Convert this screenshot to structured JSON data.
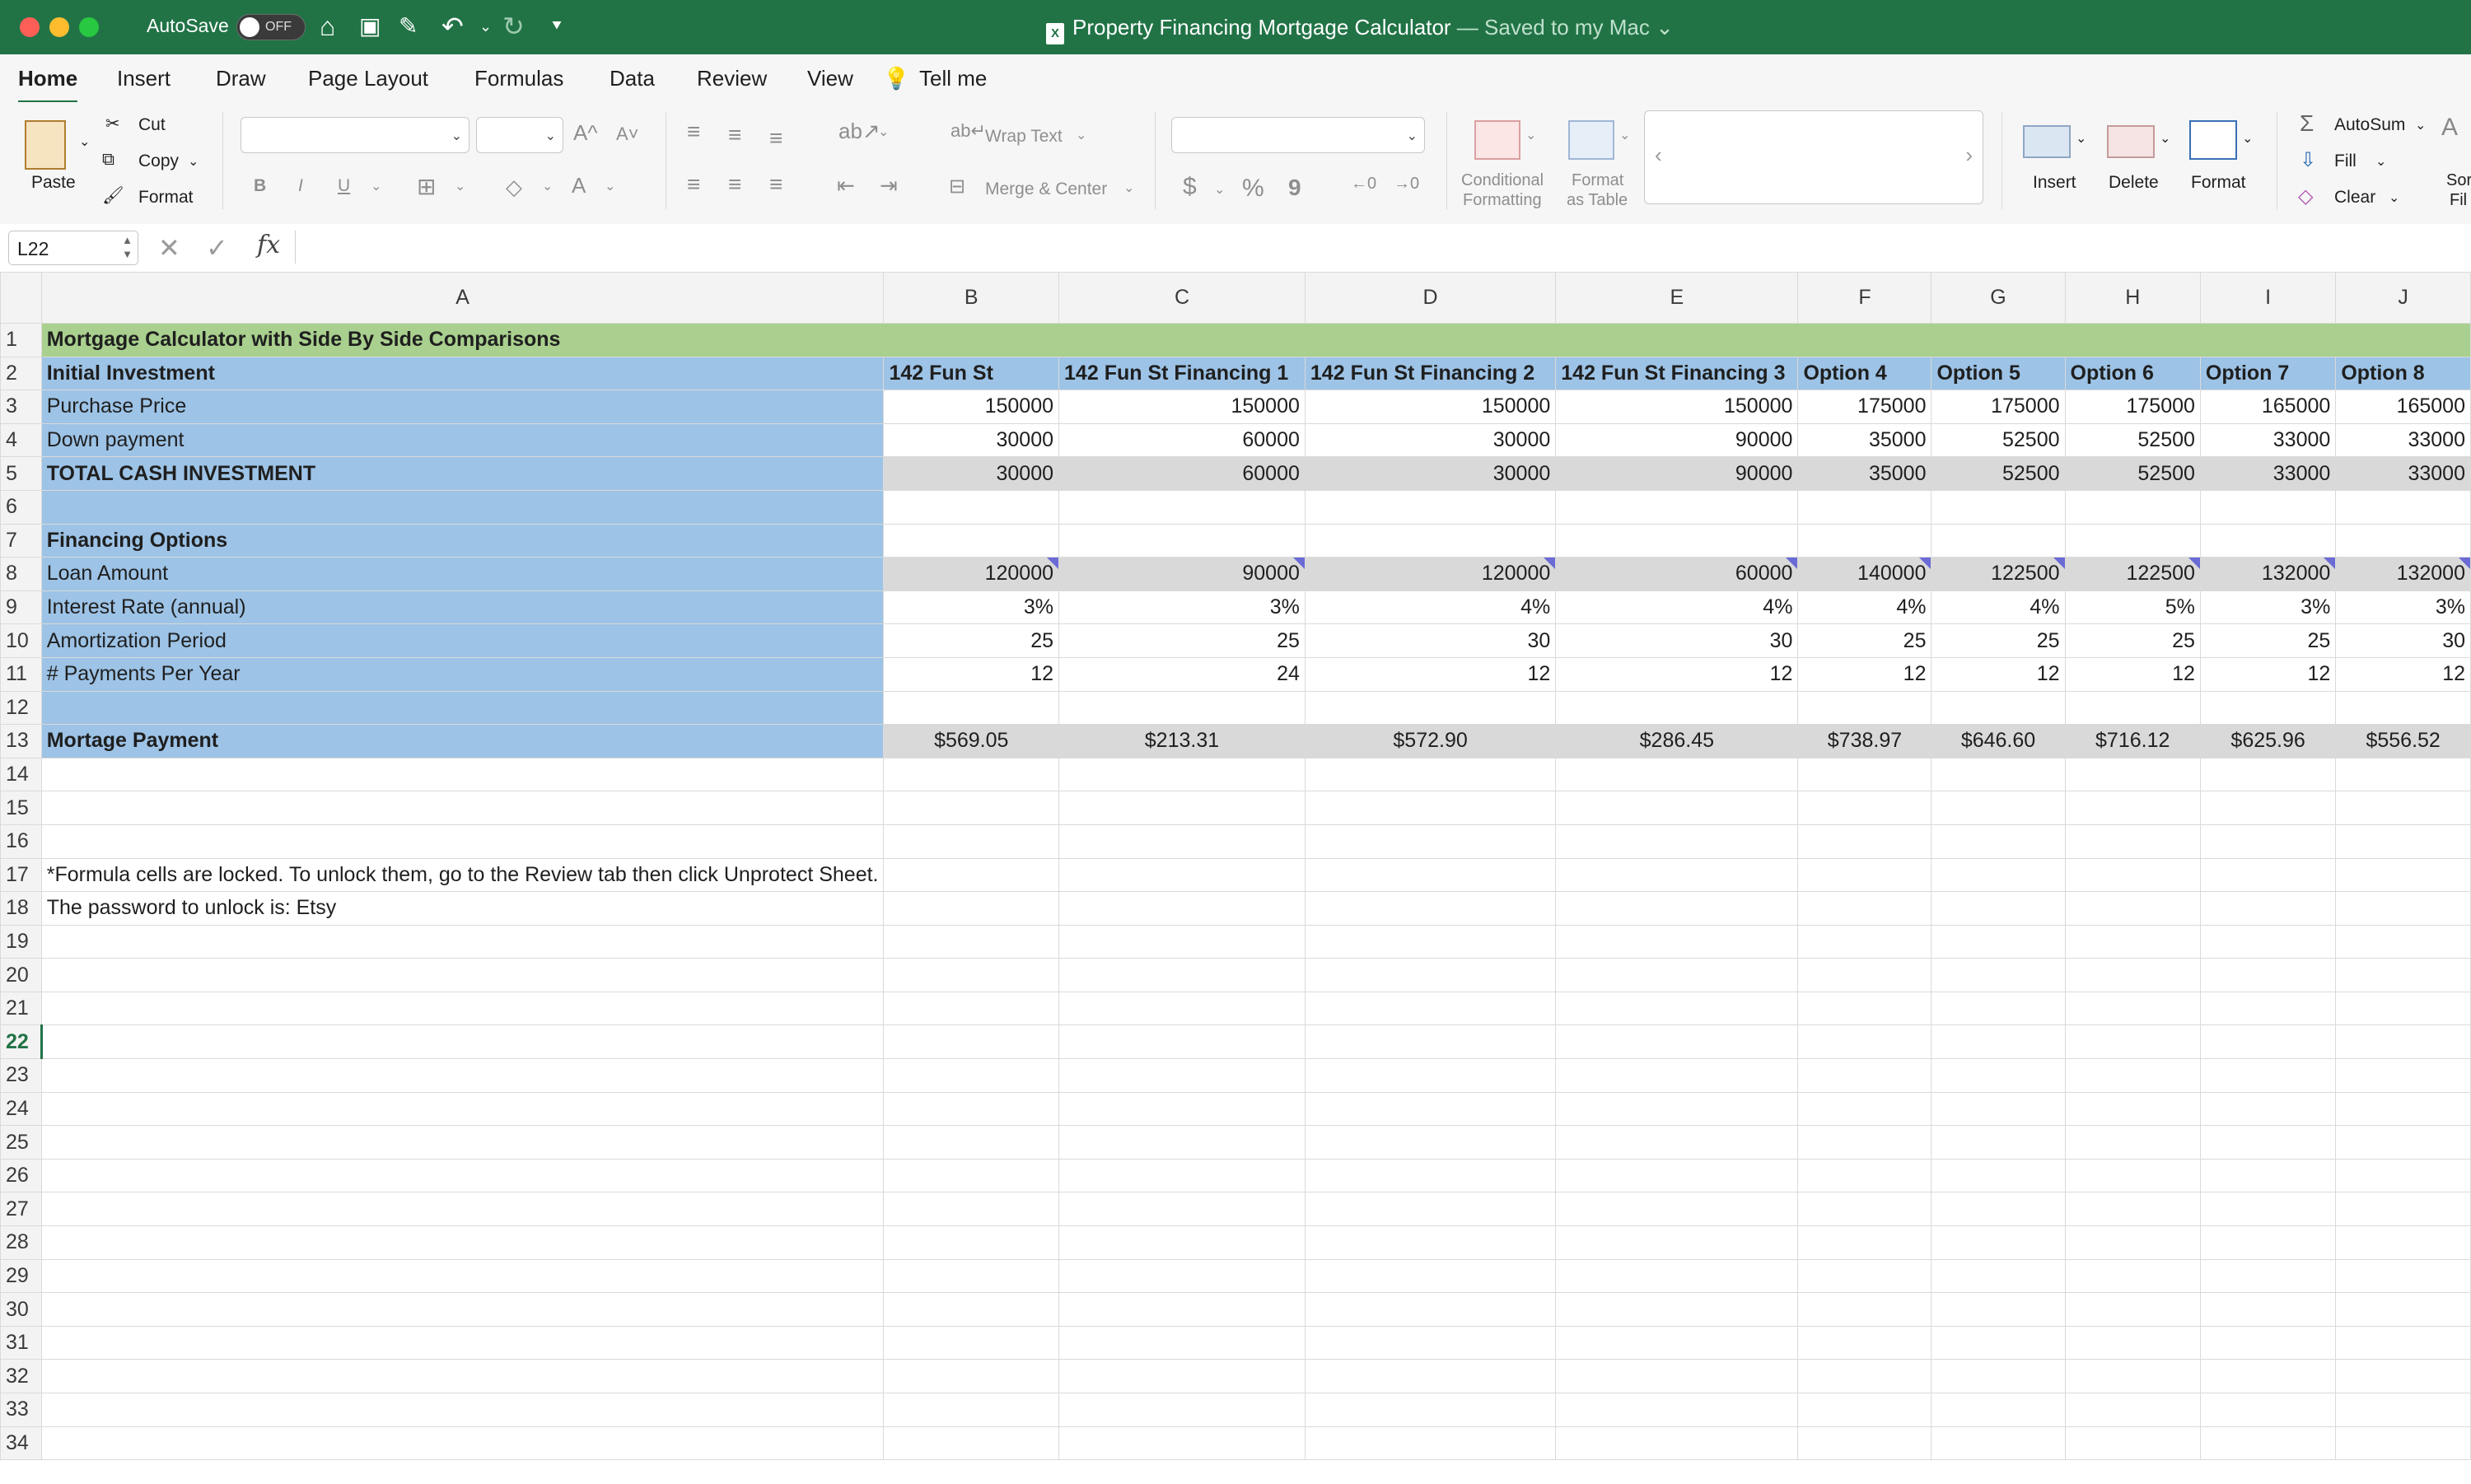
{
  "titlebar": {
    "autosave_label": "AutoSave",
    "autosave_state": "OFF",
    "doc_title": "Property Financing Mortgage Calculator",
    "saved_status": "— Saved to my Mac",
    "icons": [
      "home-icon",
      "save-icon",
      "save-as-icon",
      "undo-icon",
      "redo-icon",
      "customize-icon"
    ]
  },
  "menu": {
    "tabs": [
      "Home",
      "Insert",
      "Draw",
      "Page Layout",
      "Formulas",
      "Data",
      "Review",
      "View",
      "Tell me"
    ]
  },
  "ribbon": {
    "paste": "Paste",
    "cut": "Cut",
    "copy": "Copy",
    "format_painter": "Format",
    "bold": "B",
    "italic": "I",
    "underline": "U",
    "wrap_text": "Wrap Text",
    "merge_center": "Merge & Center",
    "currency": "$",
    "percent": "%",
    "comma": "9",
    "conditional_formatting": [
      "Conditional",
      "Formatting"
    ],
    "format_as_table": [
      "Format",
      "as Table"
    ],
    "insert": "Insert",
    "delete": "Delete",
    "format": "Format",
    "autosum": "AutoSum",
    "fill": "Fill",
    "clear": "Clear",
    "sort_filter": [
      "Sor",
      "Fil"
    ]
  },
  "formula_bar": {
    "name_box": "L22",
    "fx": "fx",
    "value": ""
  },
  "sheet": {
    "columns": [
      "A",
      "B",
      "C",
      "D",
      "E",
      "F",
      "G",
      "H",
      "I",
      "J"
    ],
    "title": "Mortgage Calculator with Side By Side Comparisons",
    "header_row": [
      "Initial Investment",
      "142 Fun St",
      "142 Fun St Financing 1",
      "142 Fun St Financing 2",
      "142 Fun St Financing 3",
      "Option 4",
      "Option 5",
      "Option 6",
      "Option 7",
      "Option 8"
    ],
    "purchase_price": {
      "label": "Purchase Price",
      "values": [
        "150000",
        "150000",
        "150000",
        "150000",
        "175000",
        "175000",
        "175000",
        "165000",
        "165000"
      ]
    },
    "down_payment": {
      "label": "Down payment",
      "values": [
        "30000",
        "60000",
        "30000",
        "90000",
        "35000",
        "52500",
        "52500",
        "33000",
        "33000"
      ]
    },
    "total_cash": {
      "label": "TOTAL CASH INVESTMENT",
      "values": [
        "30000",
        "60000",
        "30000",
        "90000",
        "35000",
        "52500",
        "52500",
        "33000",
        "33000"
      ]
    },
    "financing_options": "Financing Options",
    "loan_amount": {
      "label": "Loan Amount",
      "values": [
        "120000",
        "90000",
        "120000",
        "60000",
        "140000",
        "122500",
        "122500",
        "132000",
        "132000"
      ]
    },
    "interest_rate": {
      "label": "Interest Rate (annual)",
      "values": [
        "3%",
        "3%",
        "4%",
        "4%",
        "4%",
        "4%",
        "5%",
        "3%",
        "3%"
      ]
    },
    "amortization": {
      "label": "Amortization Period",
      "values": [
        "25",
        "25",
        "30",
        "30",
        "25",
        "25",
        "25",
        "25",
        "30"
      ]
    },
    "payments_per_year": {
      "label": "# Payments Per Year",
      "values": [
        "12",
        "24",
        "12",
        "12",
        "12",
        "12",
        "12",
        "12",
        "12"
      ]
    },
    "mortgage_payment": {
      "label": "Mortage Payment",
      "values": [
        "$569.05",
        "$213.31",
        "$572.90",
        "$286.45",
        "$738.97",
        "$646.60",
        "$716.12",
        "$625.96",
        "$556.52"
      ]
    },
    "note_row17": "*Formula cells are locked. To unlock them, go to the Review tab then click Unprotect Sheet.",
    "note_row18": "The password to unlock is: Etsy",
    "selected_row": 22
  }
}
